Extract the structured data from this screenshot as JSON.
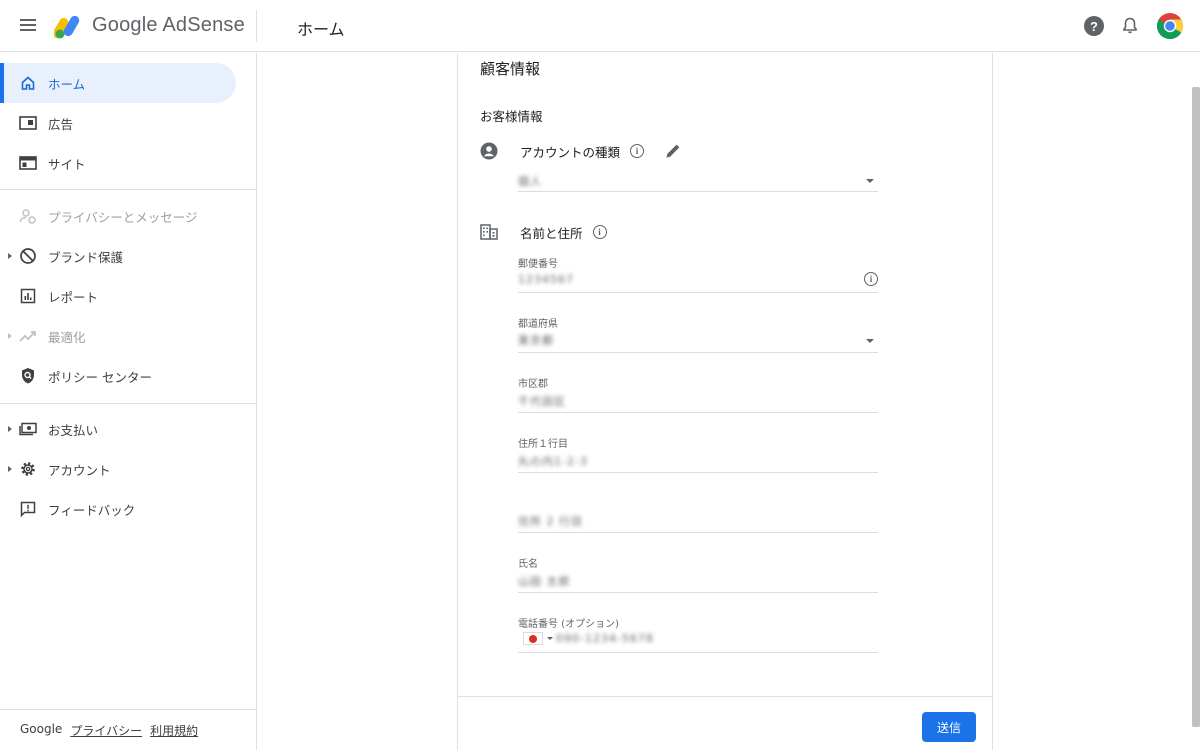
{
  "header": {
    "app_name": "Google AdSense",
    "page_title": "ホーム"
  },
  "sidebar": {
    "items": [
      {
        "label": "ホーム",
        "icon": "home-icon",
        "state": "active"
      },
      {
        "label": "広告",
        "icon": "ads-icon"
      },
      {
        "label": "サイト",
        "icon": "sites-icon"
      },
      {
        "label": "プライバシーとメッセージ",
        "icon": "privacy-icon",
        "state": "disabled"
      },
      {
        "label": "ブランド保護",
        "icon": "block-icon",
        "expandable": true
      },
      {
        "label": "レポート",
        "icon": "report-icon"
      },
      {
        "label": "最適化",
        "icon": "trending-icon",
        "state": "disabled",
        "expandable": true
      },
      {
        "label": "ポリシー センター",
        "icon": "policy-icon"
      },
      {
        "label": "お支払い",
        "icon": "payments-icon",
        "expandable": true
      },
      {
        "label": "アカウント",
        "icon": "gear-icon",
        "expandable": true
      },
      {
        "label": "フィードバック",
        "icon": "feedback-icon"
      }
    ],
    "footer": {
      "google": "Google",
      "privacy": "プライバシー",
      "terms": "利用規約"
    }
  },
  "form": {
    "title": "顧客情報",
    "section_title": "お客様情報",
    "account_type": {
      "label": "アカウントの種類",
      "value": "個人"
    },
    "name_address": {
      "label": "名前と住所",
      "fields": [
        {
          "label": "郵便番号",
          "value": "1234567"
        },
        {
          "label": "都道府県",
          "value": "東京都"
        },
        {
          "label": "市区郡",
          "value": "千代田区"
        },
        {
          "label": "住所１行目",
          "value": "丸の内1-2-3"
        },
        {
          "label": "",
          "value": "住所 2 行目"
        },
        {
          "label": "氏名",
          "value": "山田 太郎"
        },
        {
          "label": "電話番号 (オプション)",
          "value": "090-1234-5678"
        }
      ]
    },
    "submit_label": "送信"
  },
  "colors": {
    "accent": "#1a73e8",
    "active_bg": "#e8f0fe"
  }
}
